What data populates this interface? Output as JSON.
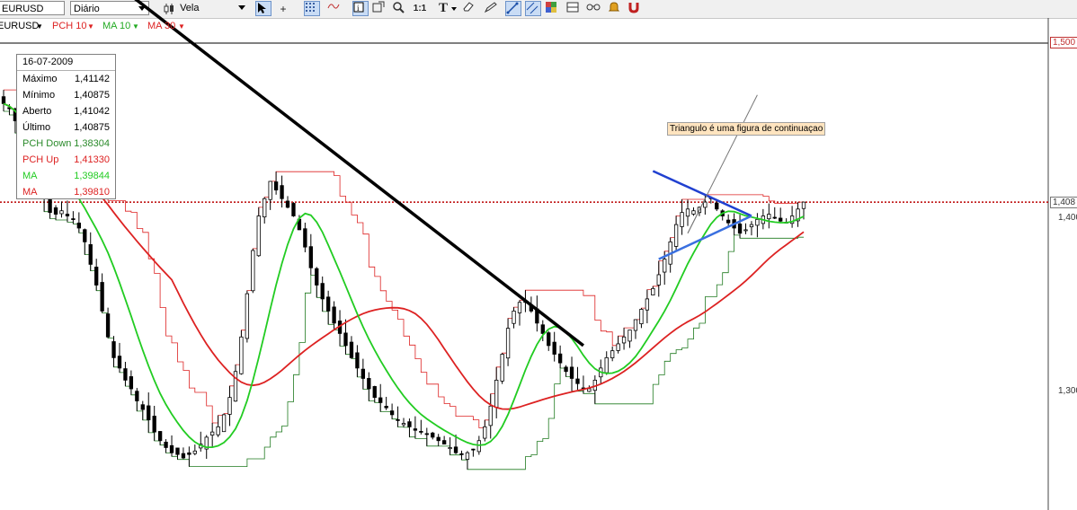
{
  "toolbar": {
    "symbol": "EURUSD",
    "period": "Diário",
    "chart_style": "Vela",
    "tools": [
      "cursor-tool",
      "crosshair-tool",
      "grid-tool",
      "indicator-tool",
      "info-tool",
      "zoom-in-tool",
      "zoom-out-tool",
      "scale-1-1-tool",
      "text-tool",
      "eraser-tool",
      "pencil-tool",
      "trendline-tool",
      "channel-tool",
      "palette-tool",
      "layout-tool",
      "glasses-tool",
      "alert-tool",
      "magnet-tool"
    ],
    "scale_label": "1:1",
    "text_tool_label": "T"
  },
  "legend": {
    "symbol": "EURUSD",
    "pch": "PCH 10",
    "ma10": "MA 10",
    "ma30": "MA 30"
  },
  "infobox": {
    "date": "16-07-2009",
    "rows": [
      {
        "label": "Máximo",
        "value": "1,41142",
        "color": "#000000"
      },
      {
        "label": "Mínimo",
        "value": "1,40875",
        "color": "#000000"
      },
      {
        "label": "Aberto",
        "value": "1,41042",
        "color": "#000000"
      },
      {
        "label": "Último",
        "value": "1,40875",
        "color": "#000000"
      },
      {
        "label": "PCH Down",
        "value": "1,38304",
        "color": "#2a8a2a"
      },
      {
        "label": "PCH Up",
        "value": "1,41330",
        "color": "#dd2222"
      },
      {
        "label": "MA",
        "value": "1,39844",
        "color": "#22cc22"
      },
      {
        "label": "MA",
        "value": "1,39810",
        "color": "#dd2222"
      }
    ]
  },
  "annotation": "Triangulo é uma figura de continuaçao",
  "colors": {
    "candle": "#000000",
    "pch_up": "#dd2222",
    "pch_down": "#1f7a1f",
    "ma10": "#22cc22",
    "ma30": "#dd2222",
    "trendline": "#000000",
    "triangle": "#2040d0",
    "current_price_line": "#bb0000"
  },
  "chart_data": {
    "type": "candlestick",
    "title": "",
    "y_axis": {
      "min": 1.245,
      "max": 1.51,
      "ticks": [
        "1,500",
        "1,408",
        "1,400",
        "1,300"
      ],
      "current_price": "1,408"
    },
    "series": [
      {
        "name": "EURUSD",
        "kind": "candles",
        "close": [
          1.465,
          1.462,
          1.455,
          1.448,
          1.44,
          1.432,
          1.421,
          1.41,
          1.402,
          1.401,
          1.403,
          1.4,
          1.398,
          1.393,
          1.385,
          1.372,
          1.36,
          1.345,
          1.33,
          1.318,
          1.312,
          1.305,
          1.3,
          1.293,
          1.288,
          1.282,
          1.275,
          1.27,
          1.266,
          1.263,
          1.262,
          1.26,
          1.262,
          1.264,
          1.268,
          1.272,
          1.275,
          1.278,
          1.285,
          1.295,
          1.31,
          1.33,
          1.355,
          1.38,
          1.4,
          1.41,
          1.42,
          1.415,
          1.41,
          1.405,
          1.4,
          1.392,
          1.382,
          1.37,
          1.36,
          1.352,
          1.345,
          1.338,
          1.332,
          1.325,
          1.318,
          1.312,
          1.306,
          1.3,
          1.295,
          1.292,
          1.289,
          1.285,
          1.282,
          1.28,
          1.278,
          1.276,
          1.275,
          1.274,
          1.272,
          1.27,
          1.268,
          1.266,
          1.263,
          1.262,
          1.263,
          1.265,
          1.27,
          1.278,
          1.29,
          1.305,
          1.32,
          1.335,
          1.345,
          1.35,
          1.35,
          1.345,
          1.338,
          1.332,
          1.325,
          1.32,
          1.315,
          1.31,
          1.306,
          1.303,
          1.3,
          1.3,
          1.305,
          1.312,
          1.318,
          1.322,
          1.326,
          1.33,
          1.334,
          1.34,
          1.346,
          1.352,
          1.358,
          1.366,
          1.375,
          1.385,
          1.395,
          1.402,
          1.404,
          1.403,
          1.405,
          1.408,
          1.41,
          1.404,
          1.4,
          1.396,
          1.393,
          1.39,
          1.392,
          1.395,
          1.398,
          1.4,
          1.401,
          1.399,
          1.397,
          1.396,
          1.4,
          1.404,
          1.408
        ]
      },
      {
        "name": "PCH 10 Up",
        "kind": "line",
        "color": "#dd2222"
      },
      {
        "name": "PCH 10 Down",
        "kind": "line",
        "color": "#1f7a1f"
      },
      {
        "name": "MA 10",
        "kind": "line",
        "color": "#22cc22"
      },
      {
        "name": "MA 30",
        "kind": "line",
        "color": "#dd2222"
      }
    ],
    "drawings": {
      "trendline": {
        "from": {
          "index": 21,
          "price": 1.53
        },
        "to": {
          "index": 100,
          "price": 1.325
        }
      },
      "triangle_upper": {
        "from": {
          "index": 112,
          "price": 1.426
        },
        "to": {
          "index": 129,
          "price": 1.4
        }
      },
      "triangle_lower": {
        "from": {
          "index": 113,
          "price": 1.375
        },
        "to": {
          "index": 129,
          "price": 1.4
        }
      },
      "projection": {
        "from": {
          "index": 118,
          "price": 1.39
        },
        "to": {
          "index": 130,
          "price": 1.47
        }
      }
    }
  }
}
